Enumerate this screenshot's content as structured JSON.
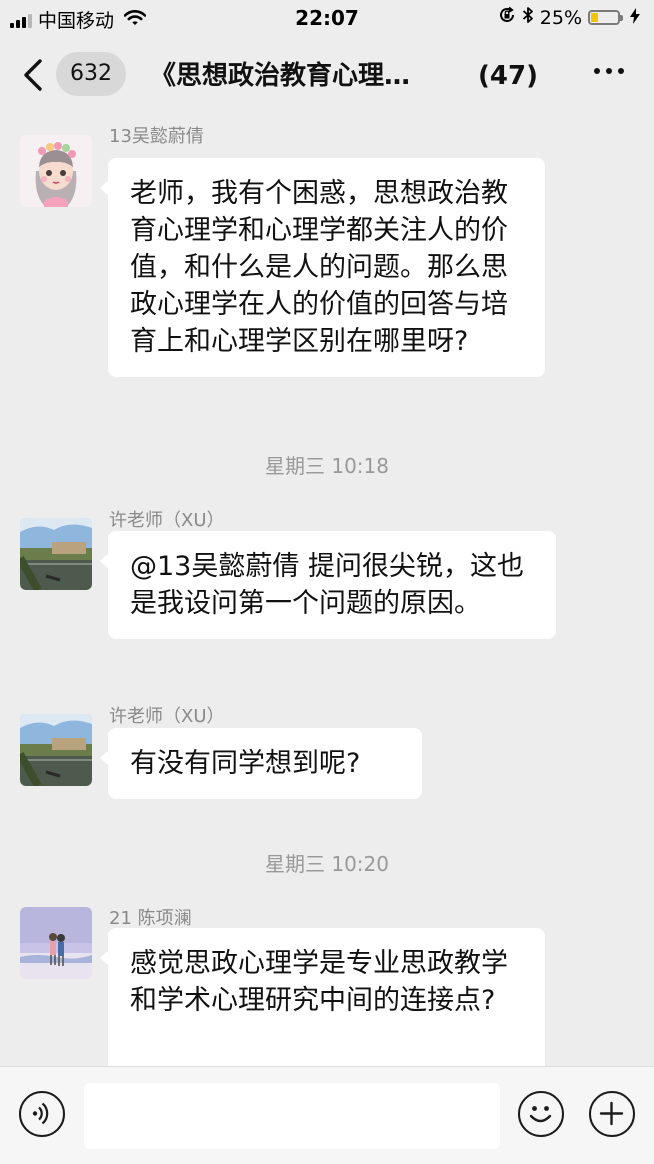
{
  "status_bar": {
    "carrier": "中国移动",
    "time": "22:07",
    "battery_percent": "25%",
    "battery_level": 0.25,
    "icons": [
      "signal-icon",
      "wifi-icon",
      "lock-rotation-icon",
      "bluetooth-icon",
      "battery-icon",
      "charging-icon"
    ]
  },
  "nav": {
    "unread_count": "632",
    "title": "《思想政治教育心理…",
    "member_count": "(47)"
  },
  "messages": [
    {
      "type": "message",
      "sender": "13吴懿蔚倩",
      "avatar": "cartoon-girl-flower-crown",
      "text": "老师，我有个困惑，思想政治教育心理学和心理学都关注人的价值，和什么是人的问题。那么思政心理学在人的价值的回答与培育上和心理学区别在哪里呀?"
    },
    {
      "type": "timestamp",
      "text": "星期三 10:18"
    },
    {
      "type": "message",
      "sender": "许老师（XU）",
      "avatar": "river-landscape",
      "text": "@13吴懿蔚倩  提问很尖锐，这也是我设问第一个问题的原因。"
    },
    {
      "type": "message",
      "sender": "许老师（XU）",
      "avatar": "river-landscape",
      "text": "有没有同学想到呢?"
    },
    {
      "type": "timestamp",
      "text": "星期三 10:20"
    },
    {
      "type": "message",
      "sender": "21 陈项澜",
      "avatar": "couple-on-beach",
      "text": "感觉思政心理学是专业思政教学和学术心理研究中间的连接点?"
    }
  ],
  "input_bar": {
    "placeholder": "",
    "icons": [
      "voice-icon",
      "emoji-icon",
      "plus-icon"
    ]
  },
  "colors": {
    "background": "#ededed",
    "bubble": "#ffffff",
    "battery_fill": "#f2c400",
    "meta_text": "#999999"
  }
}
